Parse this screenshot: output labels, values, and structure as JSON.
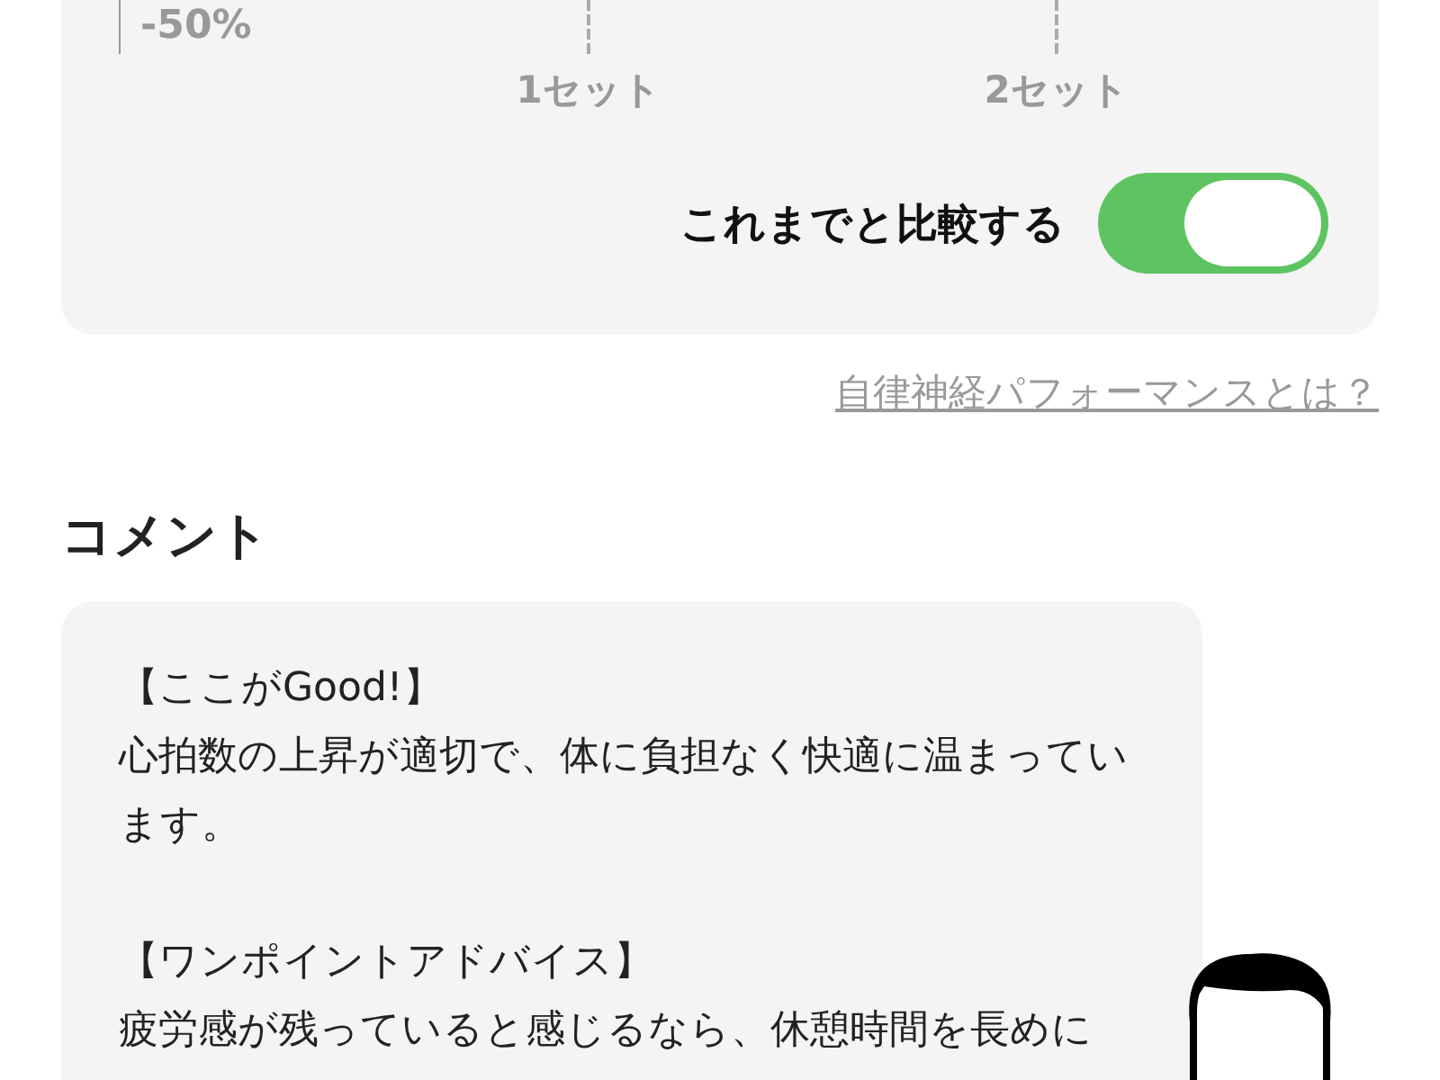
{
  "chart": {
    "y_label": "-50%",
    "x_labels": [
      "1セット",
      "2セット"
    ]
  },
  "compare_toggle": {
    "label": "これまでと比較する",
    "on": true
  },
  "help_link": "自律神経パフォーマンスとは？",
  "comment_section": {
    "title": "コメント",
    "blocks": [
      {
        "heading": "【ここがGood!】",
        "body": "心拍数の上昇が適切で、体に負担なく快適に温まっています。"
      },
      {
        "heading": "【ワンポイントアドバイス】",
        "body": "疲労感が残っていると感じるなら、休憩時間を長めに"
      }
    ]
  }
}
